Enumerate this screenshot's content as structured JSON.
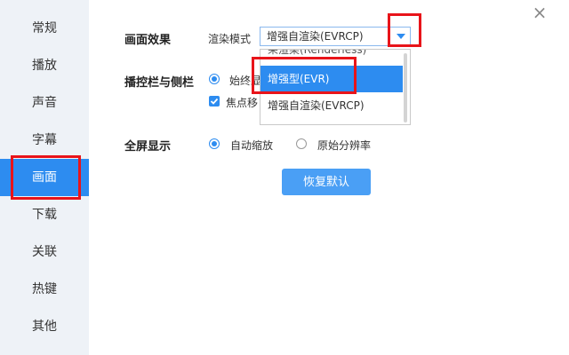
{
  "sidebar": {
    "items": [
      {
        "label": "常规"
      },
      {
        "label": "播放"
      },
      {
        "label": "声音"
      },
      {
        "label": "字幕"
      },
      {
        "label": "画面"
      },
      {
        "label": "下载"
      },
      {
        "label": "关联"
      },
      {
        "label": "热键"
      },
      {
        "label": "其他"
      }
    ],
    "active_index": 4
  },
  "dialog": {
    "close_icon": "×"
  },
  "display": {
    "section_label": "画面效果",
    "render_mode_label": "渲染模式",
    "render_mode_value": "增强自渲染(EVRCP)",
    "options": [
      {
        "label": "呆渲染(Renderless)"
      },
      {
        "label": "增强型(EVR)"
      },
      {
        "label": "增强自渲染(EVRCP)"
      }
    ],
    "highlighted_option": "增强型(EVR)"
  },
  "control_bar": {
    "section_label": "播控栏与侧栏",
    "radio_label": "始终显",
    "checkbox_label": "焦点移"
  },
  "fullscreen": {
    "section_label": "全屏显示",
    "option_auto": "自动缩放",
    "option_original": "原始分辨率",
    "selected": "自动缩放"
  },
  "actions": {
    "restore_default": "恢复默认"
  },
  "colors": {
    "accent": "#2d8cf0",
    "annotation": "#e8141a",
    "sidebar_bg": "#eef2f7"
  }
}
